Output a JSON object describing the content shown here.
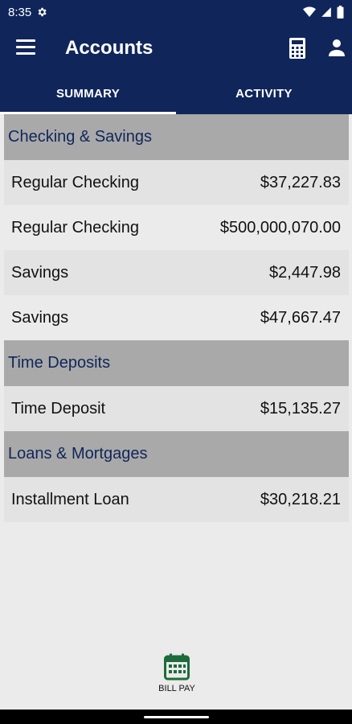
{
  "status_bar": {
    "time": "8:35"
  },
  "app_bar": {
    "title": "Accounts"
  },
  "tabs": [
    {
      "label": "SUMMARY",
      "active": true
    },
    {
      "label": "ACTIVITY",
      "active": false
    }
  ],
  "sections": [
    {
      "title": "Checking & Savings",
      "accounts": [
        {
          "name": "Regular Checking",
          "balance": "$37,227.83"
        },
        {
          "name": "Regular Checking",
          "balance": "$500,000,070.00"
        },
        {
          "name": "Savings",
          "balance": "$2,447.98"
        },
        {
          "name": "Savings",
          "balance": "$47,667.47"
        }
      ]
    },
    {
      "title": "Time Deposits",
      "accounts": [
        {
          "name": "Time Deposit",
          "balance": "$15,135.27"
        }
      ]
    },
    {
      "title": "Loans & Mortgages",
      "accounts": [
        {
          "name": "Installment Loan",
          "balance": "$30,218.21"
        }
      ]
    }
  ],
  "bottom_nav": {
    "bill_pay_label": "BILL PAY"
  },
  "colors": {
    "header_bg": "#10265a",
    "section_bg": "#a9a9a9",
    "section_text": "#10265a",
    "bill_pay_icon": "#1d6b3a"
  }
}
